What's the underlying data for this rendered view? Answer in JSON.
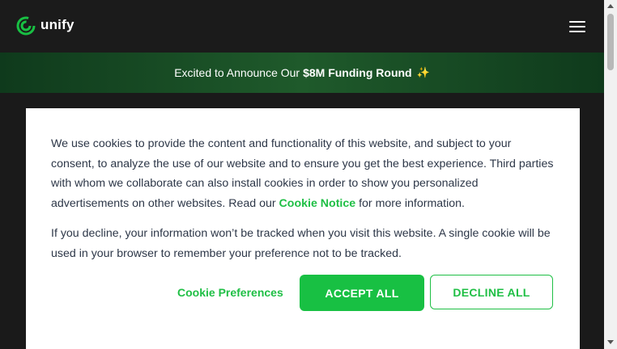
{
  "header": {
    "logo_text": "unify",
    "menu_icon": "hamburger-menu-icon"
  },
  "banner": {
    "text_prefix": "Excited to Announce Our",
    "text_bold": "$8M Funding Round",
    "icon": "sparkle-icon",
    "icon_glyph": "✨"
  },
  "cookie_modal": {
    "para1_before_link": "We use cookies to provide the content and functionality of this website, and subject to your consent, to analyze the use of our website and to ensure you get the best experience. Third parties with whom we collaborate can also install cookies in order to show you personalized advertisements on other websites. Read our ",
    "para1_link": "Cookie Notice",
    "para1_after_link": " for more information.",
    "para2": "If you decline, your information won’t be tracked when you visit this website. A single cookie will be used in your browser to remember your preference not to be tracked.",
    "preferences_label": "Cookie Preferences",
    "accept_label": "ACCEPT ALL",
    "decline_label": "DECLINE ALL"
  },
  "colors": {
    "brand_green": "#18c043",
    "header_bg": "#1b1b1b",
    "banner_green": "#1f5a2b",
    "body_text": "#2d3748"
  }
}
